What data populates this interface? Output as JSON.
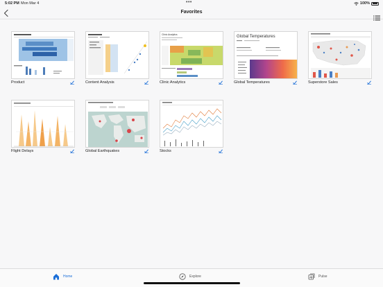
{
  "status": {
    "time": "5:02 PM",
    "date": "Mon Mar 4",
    "battery": "100%",
    "battery_level": 1.0
  },
  "header": {
    "title": "Favorites"
  },
  "cards": [
    {
      "label": "Product"
    },
    {
      "label": "Content Analysis"
    },
    {
      "label": "Clinic Analytics"
    },
    {
      "label": "Global Temperatures"
    },
    {
      "label": "Superstore Sales"
    },
    {
      "label": "Flight Delays"
    },
    {
      "label": "Global Earthquakes"
    },
    {
      "label": "Stocks"
    }
  ],
  "thumbnails": {
    "clinic_title": "Clinic Analytics",
    "global_temps_title": "Global Temperatures"
  },
  "tabs": {
    "home": "Home",
    "explore": "Explore",
    "pulse": "Pulse"
  },
  "colors": {
    "accent": "#1a6ed8",
    "background": "#f7f7f8"
  },
  "icons": {
    "back": "chevron-left-icon",
    "list": "list-view-icon",
    "favorite": "favorite-check-icon",
    "home": "house-icon",
    "explore": "compass-icon",
    "pulse": "pulse-icon"
  }
}
